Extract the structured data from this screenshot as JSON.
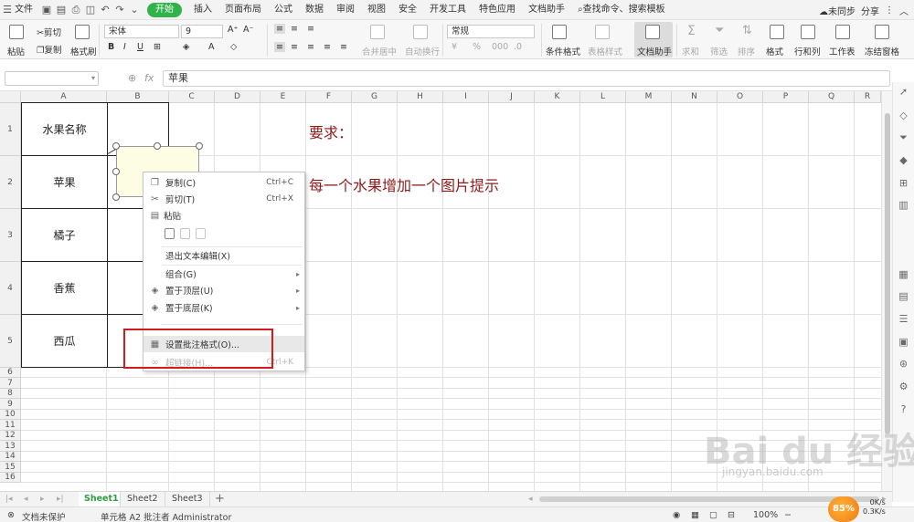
{
  "menubar": {
    "file": "文件",
    "start": "开始",
    "tabs": [
      "插入",
      "页面布局",
      "公式",
      "数据",
      "审阅",
      "视图",
      "安全",
      "开发工具",
      "特色应用",
      "文档助手"
    ],
    "search": "查找命令、搜索模板",
    "sync": "未同步",
    "share": "分享"
  },
  "ribbon": {
    "paste": "粘贴",
    "cut": "剪切",
    "copy": "复制",
    "format_painter": "格式刷",
    "font_name": "宋体",
    "font_size": "9",
    "merge_center": "合并居中",
    "auto_wrap": "自动换行",
    "number_format": "常规",
    "conditional_format": "条件格式",
    "table_style": "表格样式",
    "doc_helper": "文档助手",
    "sum": "求和",
    "filter": "筛选",
    "sort": "排序",
    "format": "格式",
    "row_col": "行和列",
    "worksheet": "工作表",
    "freeze": "冻结窗格",
    "percent": "%"
  },
  "formula_bar": {
    "fx": "fx",
    "value": "苹果"
  },
  "grid": {
    "columns": [
      "A",
      "B",
      "C",
      "D",
      "E",
      "F",
      "G",
      "H",
      "I",
      "J",
      "K",
      "L",
      "M",
      "N",
      "O",
      "P",
      "Q",
      "R"
    ],
    "rows": [
      "1",
      "2",
      "3",
      "4",
      "5",
      "6",
      "7",
      "8",
      "9",
      "10",
      "11",
      "12",
      "13",
      "14",
      "15",
      "16"
    ],
    "cells": {
      "a1": "水果名称",
      "a2": "苹果",
      "a3": "橘子",
      "a4": "香蕉",
      "a5": "西瓜"
    },
    "requirement_title": "要求：",
    "requirement_text": "每一个水果增加一个图片提示"
  },
  "context_menu": {
    "copy": {
      "label": "复制(C)",
      "shortcut": "Ctrl+C"
    },
    "cut": {
      "label": "剪切(T)",
      "shortcut": "Ctrl+X"
    },
    "paste": {
      "label": "粘贴"
    },
    "exit_text_edit": {
      "label": "退出文本编辑(X)"
    },
    "group": {
      "label": "组合(G)"
    },
    "bring_to_front": {
      "label": "置于顶层(U)"
    },
    "send_to_back": {
      "label": "置于底层(K)"
    },
    "set_comment_format": {
      "label": "设置批注格式(O)..."
    },
    "hyperlink": {
      "label": "超链接(H)...",
      "shortcut": "Ctrl+K"
    }
  },
  "sheets": [
    "Sheet1",
    "Sheet2",
    "Sheet3"
  ],
  "add_sheet": "+",
  "statusbar": {
    "protect": "文档未保护",
    "cell_info": "单元格 A2 批注者 Administrator",
    "zoom": "100%",
    "badge": "85%",
    "up": "0K/s",
    "down": "0.3K/s"
  },
  "watermark": {
    "main": "Bai du 经验",
    "sub": "jingyan.baidu.com"
  },
  "colors": {
    "accent_green": "#2fb34a",
    "requirement_red": "#8b1a1a",
    "highlight_box": "#d6191c",
    "comment_fill": "#fdfde3"
  }
}
